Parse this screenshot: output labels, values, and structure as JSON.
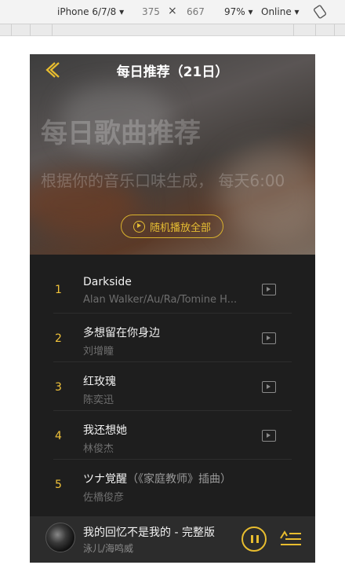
{
  "devtools": {
    "device": "iPhone 6/7/8 ▾",
    "width": "375",
    "times": "×",
    "height": "667",
    "zoom": "97% ▾",
    "network": "Online ▾"
  },
  "header": {
    "title": "每日推荐（21日）"
  },
  "hero": {
    "big_text": "每日歌曲推荐",
    "sub_text": "根据你的音乐口味生成， 每天6:00",
    "play_all_label": "随机播放全部"
  },
  "songs": [
    {
      "num": "1",
      "name": "Darkside",
      "extra": "",
      "artist": "Alan Walker/Au/Ra/Tomine H..."
    },
    {
      "num": "2",
      "name": "多想留在你身边",
      "extra": "",
      "artist": "刘增瞳"
    },
    {
      "num": "3",
      "name": "红玫瑰",
      "extra": "",
      "artist": "陈奕迅"
    },
    {
      "num": "4",
      "name": "我还想她",
      "extra": "",
      "artist": "林俊杰"
    },
    {
      "num": "5",
      "name": "ツナ覚醒",
      "extra": "（《家庭教师》插曲）",
      "artist": "佐橋俊彦"
    }
  ],
  "player": {
    "title": "我的回忆不是我的 - 完整版",
    "artist": "泳儿/海鸣威"
  },
  "colors": {
    "accent": "#e8bd2f",
    "list_bg": "#1e1e1e",
    "player_bg": "#2c2c2c"
  }
}
